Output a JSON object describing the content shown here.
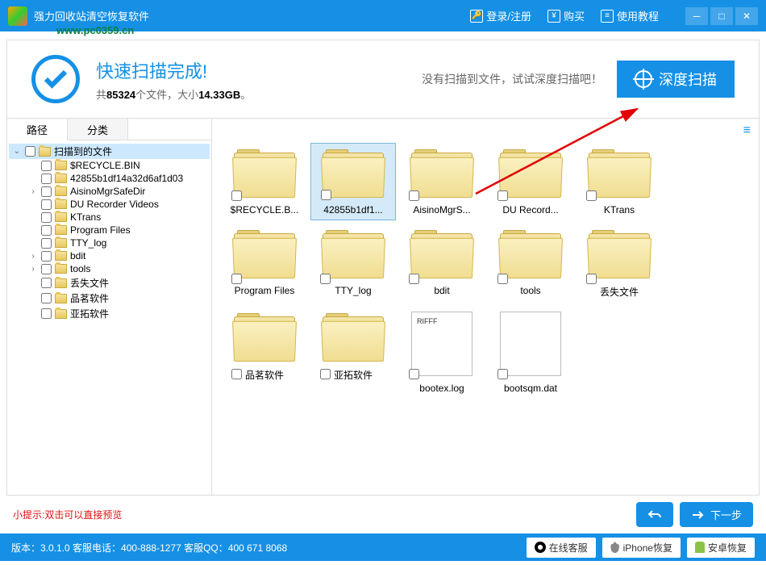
{
  "titlebar": {
    "app_name": "强力回收站清空恢复软件",
    "login": "登录/注册",
    "buy": "购买",
    "tutorial": "使用教程"
  },
  "watermark": "www.pc0359.cn",
  "banner": {
    "title": "快速扫描完成!",
    "stats_prefix": "共",
    "file_count": "85324",
    "stats_mid": "个文件，大小",
    "file_size": "14.33GB",
    "stats_suffix": "。",
    "deep_hint": "没有扫描到文件，试试深度扫描吧！",
    "deep_btn": "深度扫描"
  },
  "tabs": {
    "path": "路径",
    "category": "分类"
  },
  "tree": {
    "root": "扫描到的文件",
    "items": [
      "$RECYCLE.BIN",
      "42855b1df14a32d6af1d03",
      "AisinoMgrSafeDir",
      "DU Recorder Videos",
      "KTrans",
      "Program Files",
      "TTY_log",
      "bdit",
      "tools",
      "丢失文件",
      "品茗软件",
      "亚拓软件"
    ]
  },
  "grid": {
    "folders": [
      "$RECYCLE.B...",
      "42855b1df1...",
      "AisinoMgrS...",
      "DU Record...",
      "KTrans",
      "Program Files",
      "TTY_log",
      "bdit",
      "tools",
      "丢失文件",
      "品茗软件",
      "亚拓软件"
    ],
    "files": [
      {
        "name": "bootex.log",
        "preview": "RIFFF"
      },
      {
        "name": "bootsqm.dat",
        "preview": ""
      }
    ]
  },
  "hint": "小提示:双击可以直接预览",
  "nav": {
    "next": "下一步"
  },
  "footer": {
    "version": "版本：3.0.1.0  客服电话：400-888-1277    客服QQ：400 671 8068",
    "online": "在线客服",
    "iphone": "iPhone恢复",
    "android": "安卓恢复"
  }
}
